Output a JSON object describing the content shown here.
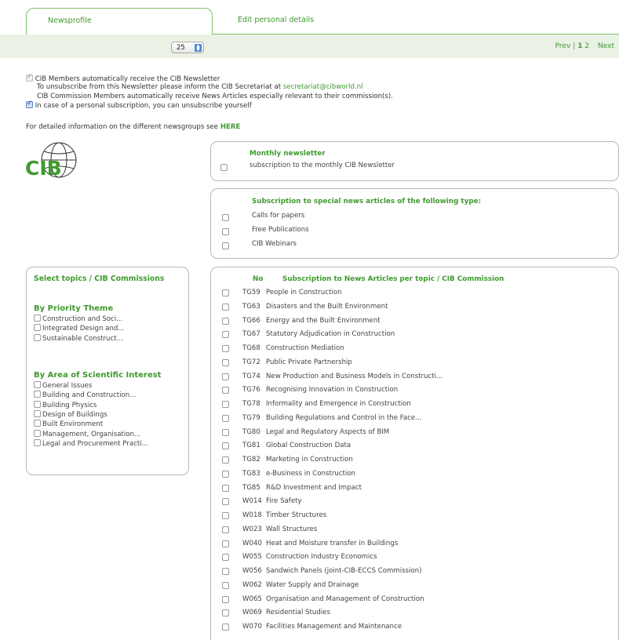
{
  "tabs": [
    {
      "label": "Newsprofile",
      "active": true
    },
    {
      "label": "Edit personal details",
      "active": false
    }
  ],
  "per_page": {
    "value": "25"
  },
  "pager": {
    "prev": "Prev",
    "pages": [
      "1",
      "2"
    ],
    "current": "1",
    "next": "Next"
  },
  "notice": {
    "line1": "CIB Members automatically receive the CIB Newsletter",
    "line2_prefix": "To unsubscribe from this Newsletter please inform the CIB Secretariat at ",
    "line2_email": "secretariat@cibworld.nl",
    "line3": "CIB Commission Members automatically receive News Articles especially relevant to their commission(s).",
    "line4": "In case of a personal subscription, you can unsubscribe yourself"
  },
  "detail": {
    "prefix": "For detailed information on the different newsgroups see ",
    "link": "HERE"
  },
  "monthly": {
    "title": "Monthly newsletter",
    "desc": "subscription to the monthly CIB Newsletter"
  },
  "special": {
    "title": "Subscription to special news articles of the following type:",
    "items": [
      "Calls for papers",
      "Free Publications",
      "CIB Webinars"
    ]
  },
  "topics": {
    "col_no": "No",
    "col_title": "Subscription to News Articles per topic / CIB Commission",
    "rows": [
      {
        "code": "TG59",
        "title": "People in Construction"
      },
      {
        "code": "TG63",
        "title": "Disasters and the Built Environment"
      },
      {
        "code": "TG66",
        "title": "Energy and the Built Environment"
      },
      {
        "code": "TG67",
        "title": "Statutory Adjudication in Construction"
      },
      {
        "code": "TG68",
        "title": "Construction Mediation"
      },
      {
        "code": "TG72",
        "title": "Public Private Partnership"
      },
      {
        "code": "TG74",
        "title": "New Production and Business Models in Constructi..."
      },
      {
        "code": "TG76",
        "title": "Recognising Innovation in Construction"
      },
      {
        "code": "TG78",
        "title": "Informality and Emergence in Construction"
      },
      {
        "code": "TG79",
        "title": "Building Regulations and Control in the Face..."
      },
      {
        "code": "TG80",
        "title": "Legal and Regulatory Aspects of BIM"
      },
      {
        "code": "TG81",
        "title": "Global Construction Data"
      },
      {
        "code": "TG82",
        "title": "Marketing in Construction"
      },
      {
        "code": "TG83",
        "title": "e-Business in Construction"
      },
      {
        "code": "TG85",
        "title": "R&D Investment and Impact"
      },
      {
        "code": "W014",
        "title": "Fire Safety"
      },
      {
        "code": "W018",
        "title": "Timber Structures"
      },
      {
        "code": "W023",
        "title": "Wall Structures"
      },
      {
        "code": "W040",
        "title": "Heat and Moisture transfer in Buildings"
      },
      {
        "code": "W055",
        "title": "Construction Industry Economics"
      },
      {
        "code": "W056",
        "title": "Sandwich Panels (joint-CIB-ECCS Commission)"
      },
      {
        "code": "W062",
        "title": "Water Supply and Drainage"
      },
      {
        "code": "W065",
        "title": "Organisation and Management of Construction"
      },
      {
        "code": "W069",
        "title": "Residential Studies"
      },
      {
        "code": "W070",
        "title": "Facilities Management and Maintenance"
      }
    ]
  },
  "sidebar": {
    "title": "Select topics / CIB Commissions",
    "priority_heading": "By Priority Theme",
    "priority_items": [
      "Construction and Soci...",
      "Integrated Design and...",
      "Sustainable Construct..."
    ],
    "area_heading": "By Area of Scientific Interest",
    "area_items": [
      "General Issues",
      "Building and Construction...",
      "Building Physics",
      "Design of Buildings",
      "Built Environment",
      "Management, Organisation...",
      "Legal and Procurement Practi..."
    ]
  },
  "logo": {
    "text": "CIB"
  },
  "colors": {
    "accent": "#3f9a2e",
    "band": "#e9f2e4"
  }
}
